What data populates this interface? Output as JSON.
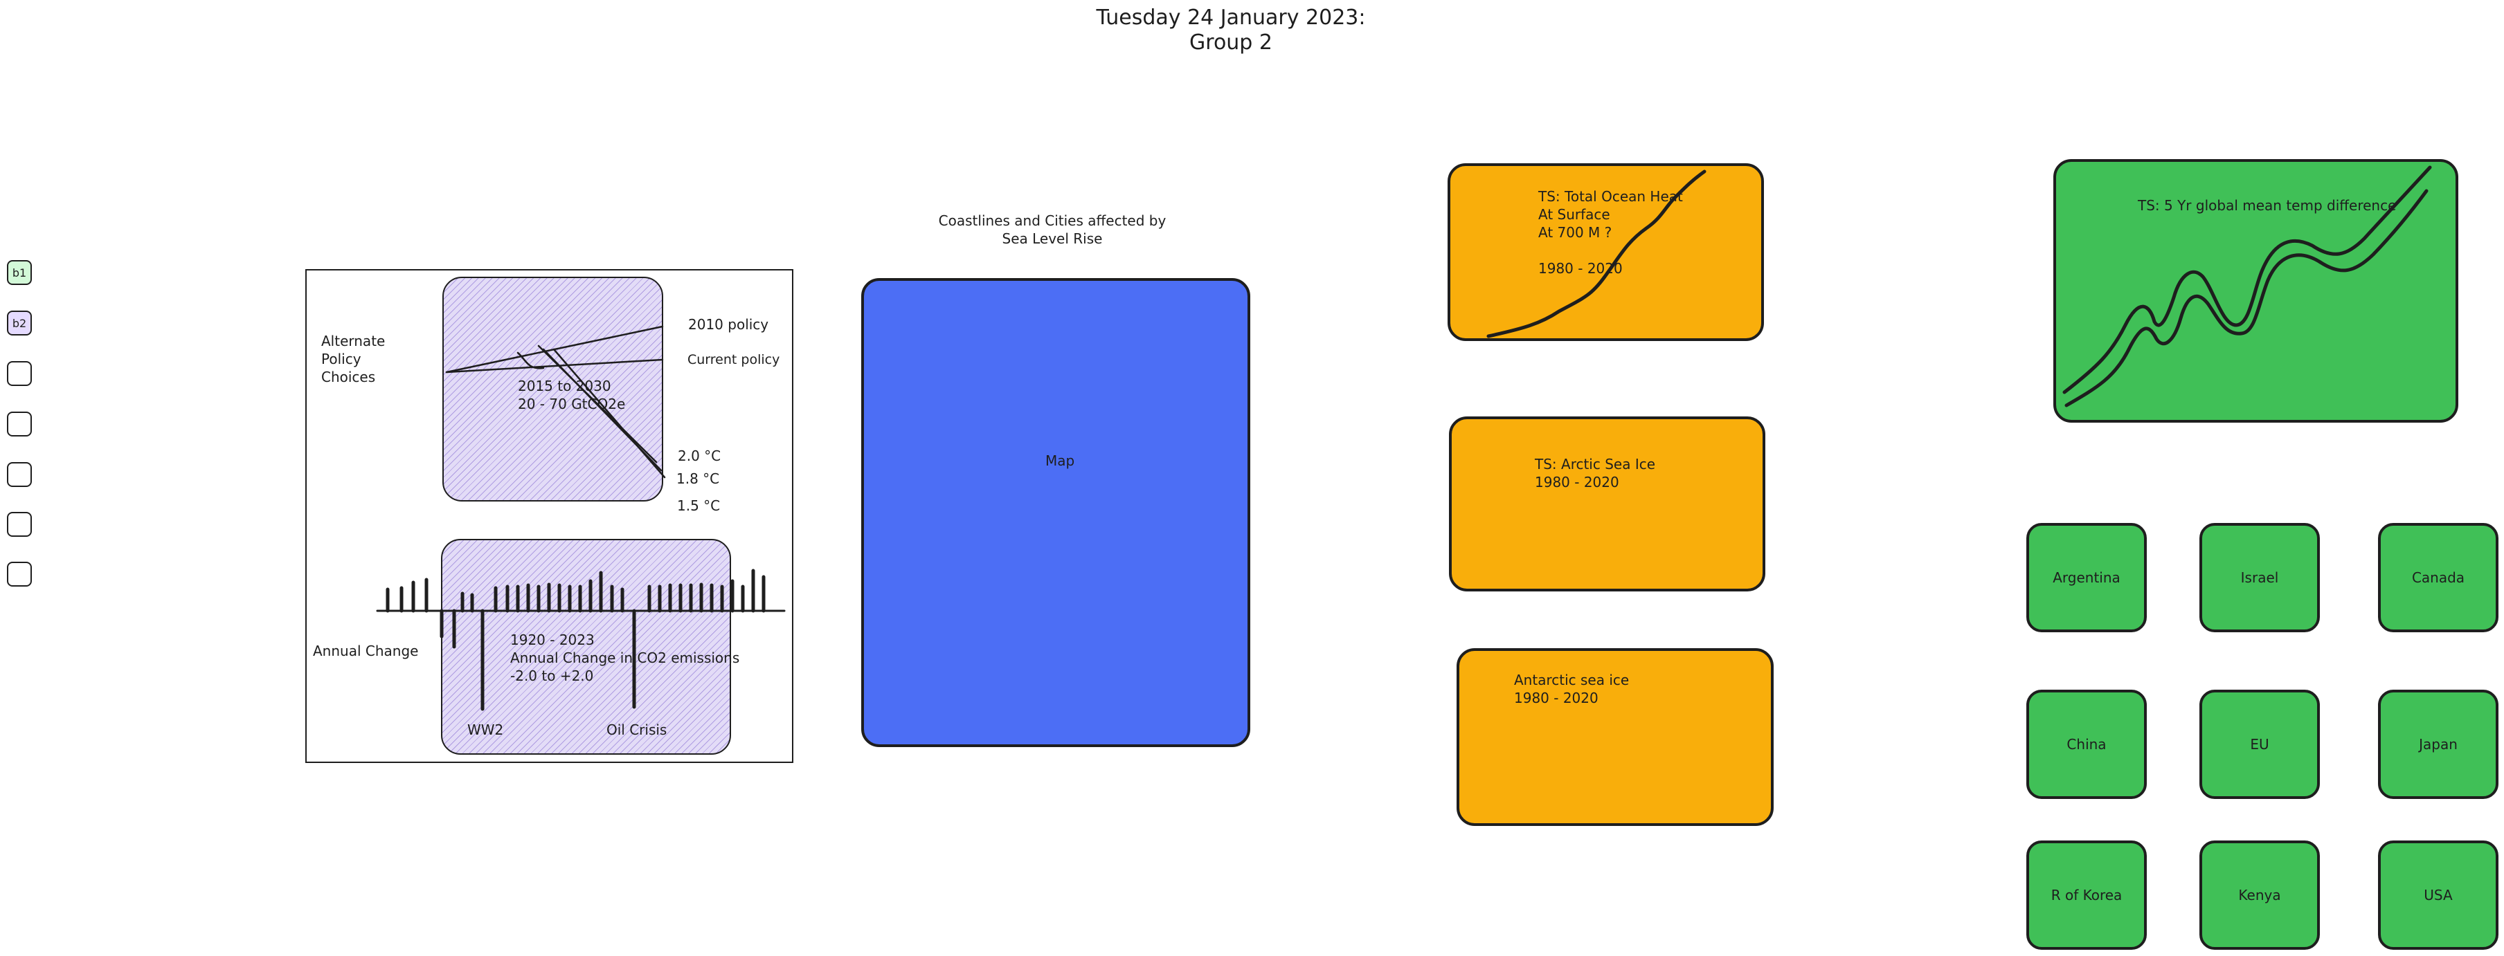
{
  "header": {
    "line1": "Tuesday 24 January 2023:",
    "line2": "Group 2"
  },
  "sidebar": {
    "checkboxes": [
      {
        "label": "b1"
      },
      {
        "label": "b2"
      },
      {
        "label": ""
      },
      {
        "label": ""
      },
      {
        "label": ""
      },
      {
        "label": ""
      },
      {
        "label": ""
      }
    ]
  },
  "policy_panel": {
    "alternate_label": "Alternate\nPolicy\nChoices",
    "policy_2010": "2010 policy",
    "policy_current": "Current policy",
    "range_text": "2015 to 2030\n20 - 70 GtCO2e",
    "temps": [
      "2.0 °C",
      "1.8 °C",
      "1.5 °C"
    ],
    "annual_change_label": "Annual Change",
    "annual_text": "1920 - 2023\nAnnual Change in CO2 emissions\n-2.0 to +2.0",
    "ww2": "WW2",
    "oil_crisis": "Oil Crisis"
  },
  "map_panel": {
    "caption": "Coastlines and Cities affected by\nSea Level Rise",
    "label": "Map"
  },
  "ts_cards": {
    "ocean_heat": "TS: Total Ocean Heat\nAt Surface\nAt 700 M ?\n\n1980 - 2020",
    "arctic": "TS: Arctic Sea Ice\n1980 - 2020",
    "antarctic": "Antarctic sea ice\n1980 - 2020",
    "global_temp": "TS: 5 Yr global mean temp difference"
  },
  "countries": [
    "Argentina",
    "Israel",
    "Canada",
    "China",
    "EU",
    "Japan",
    "R of Korea",
    "Kenya",
    "USA"
  ],
  "colors": {
    "orange": "#f9ae0b",
    "green": "#40c057",
    "blue": "#4c6ef5",
    "violet": "#e3dcf7",
    "stroke": "#1e1e1e"
  }
}
